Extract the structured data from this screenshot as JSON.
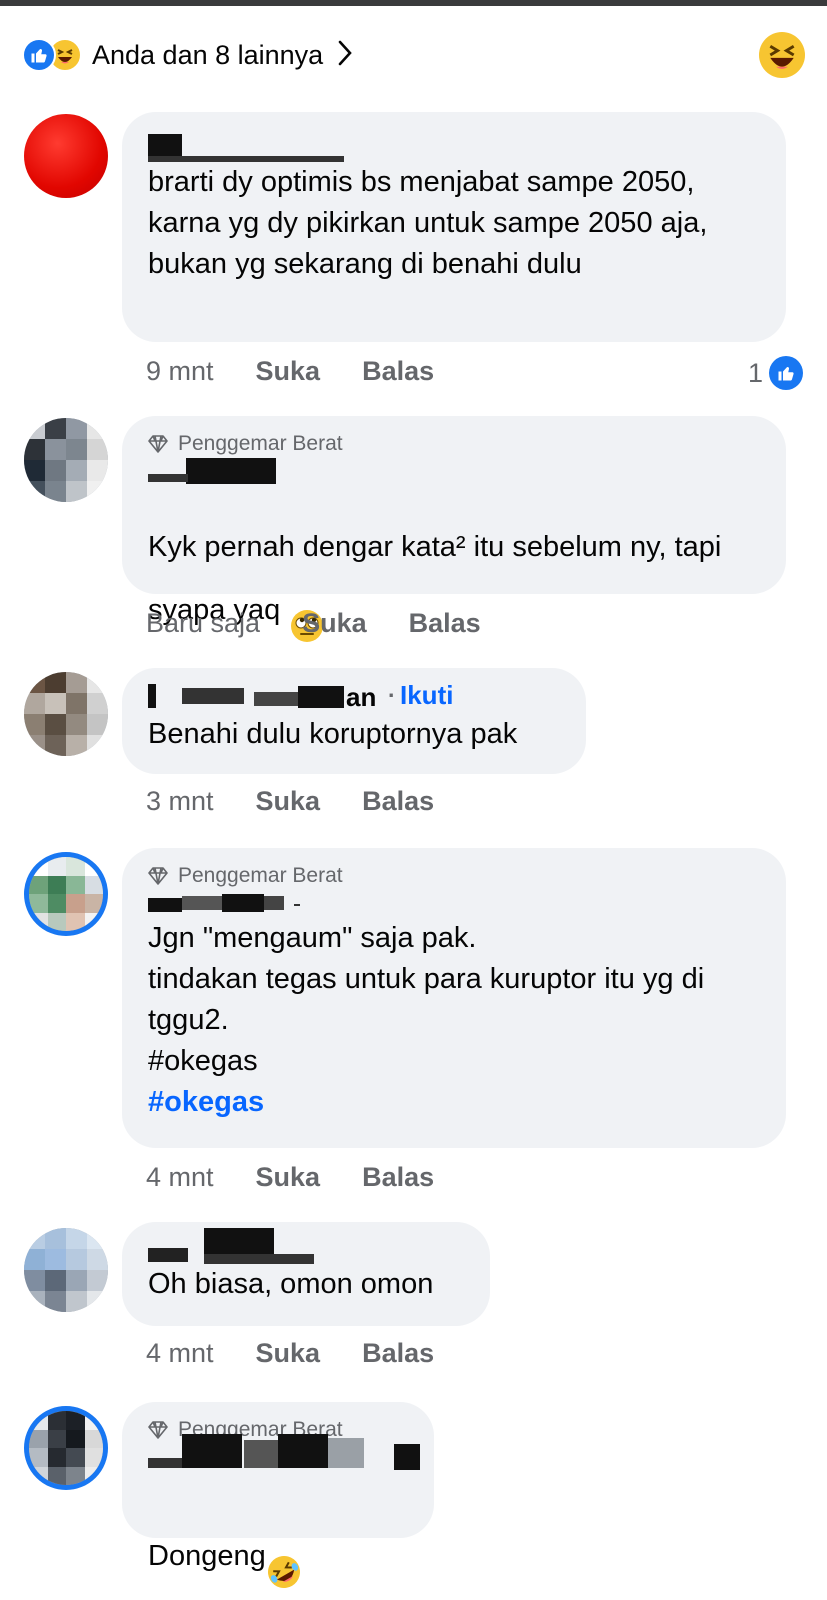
{
  "reactions": {
    "summary_label": "Anda dan 8 lainnya",
    "icons": [
      "like-icon",
      "haha-icon"
    ]
  },
  "badge_label": "Penggemar Berat",
  "action_labels": {
    "like": "Suka",
    "reply": "Balas"
  },
  "comments": [
    {
      "author_visible": "",
      "text": "brarti dy optimis bs menjabat sampe 2050, karna yg dy pikirkan untuk sampe 2050 aja, bukan yg sekarang di benahi dulu",
      "time": "9 mnt",
      "like_count": "1"
    },
    {
      "badge": true,
      "author_visible": "",
      "text": "Kyk pernah dengar kata² itu sebelum ny, tapi syapa yaq",
      "emoji": "face-with-rolling-eyes",
      "time": "Baru saja"
    },
    {
      "author_visible": "an",
      "follow_label": "Ikuti",
      "text": "Benahi dulu koruptornya pak",
      "time": "3 mnt"
    },
    {
      "badge": true,
      "author_visible": "",
      "text": "Jgn \"mengaum\" saja pak.\ntindakan tegas untuk para kuruptor itu yg di tggu2.\n#okegas",
      "hashtag": "#okegas",
      "time": "4 mnt"
    },
    {
      "author_visible": "",
      "text": "Oh biasa, omon omon",
      "time": "4 mnt"
    },
    {
      "badge": true,
      "author_visible": "",
      "text": "Dongeng",
      "emoji": "rolling-on-floor-laughing"
    }
  ],
  "colors": {
    "accent": "#0866ff",
    "like_blue": "#1877f2",
    "bubble": "#f0f2f5",
    "secondary_text": "#65676b",
    "haha_yellow": "#f7c531"
  }
}
